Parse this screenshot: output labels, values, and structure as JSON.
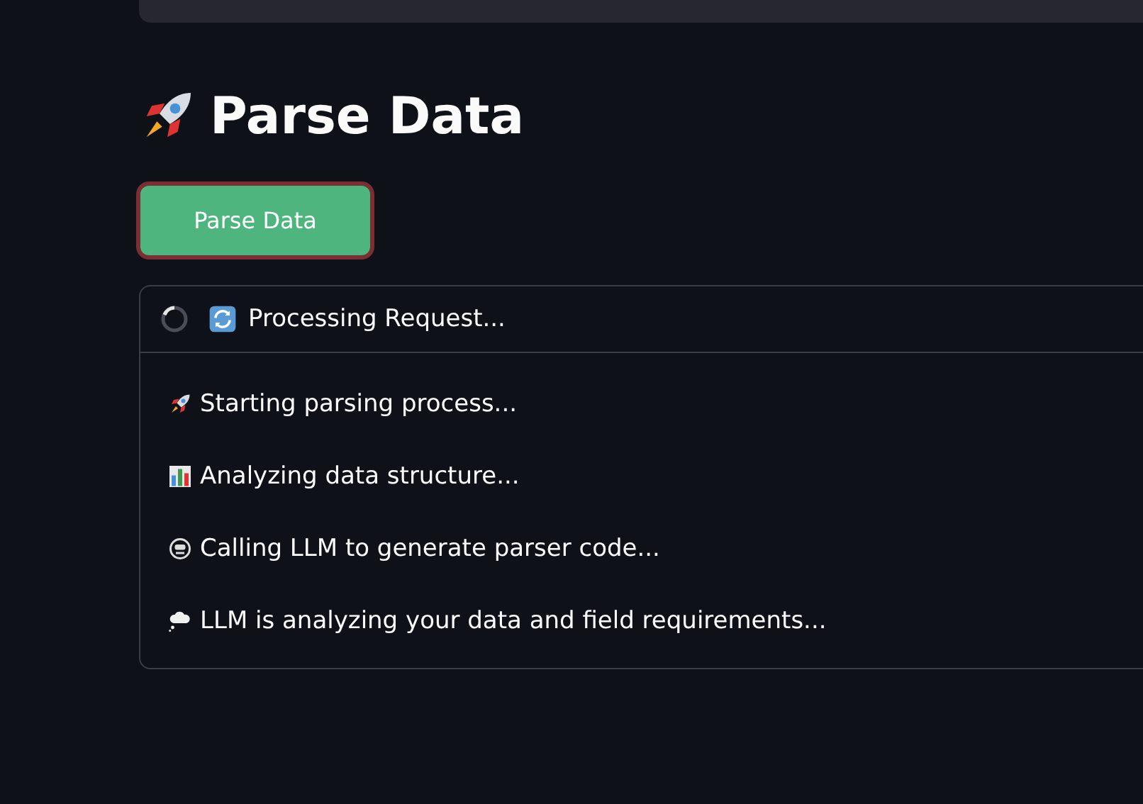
{
  "title": {
    "text": "Parse Data"
  },
  "parse_button": {
    "label": "Parse Data",
    "focused": true
  },
  "status_panel": {
    "title": "Processing Request...",
    "running": true,
    "messages": [
      {
        "kind": "rocket",
        "text": "Starting parsing process..."
      },
      {
        "kind": "chart",
        "text": "Analyzing data structure..."
      },
      {
        "kind": "face",
        "text": "Calling LLM to generate parser code..."
      },
      {
        "kind": "thought",
        "text": "LLM is analyzing your data and field requirements..."
      }
    ]
  }
}
